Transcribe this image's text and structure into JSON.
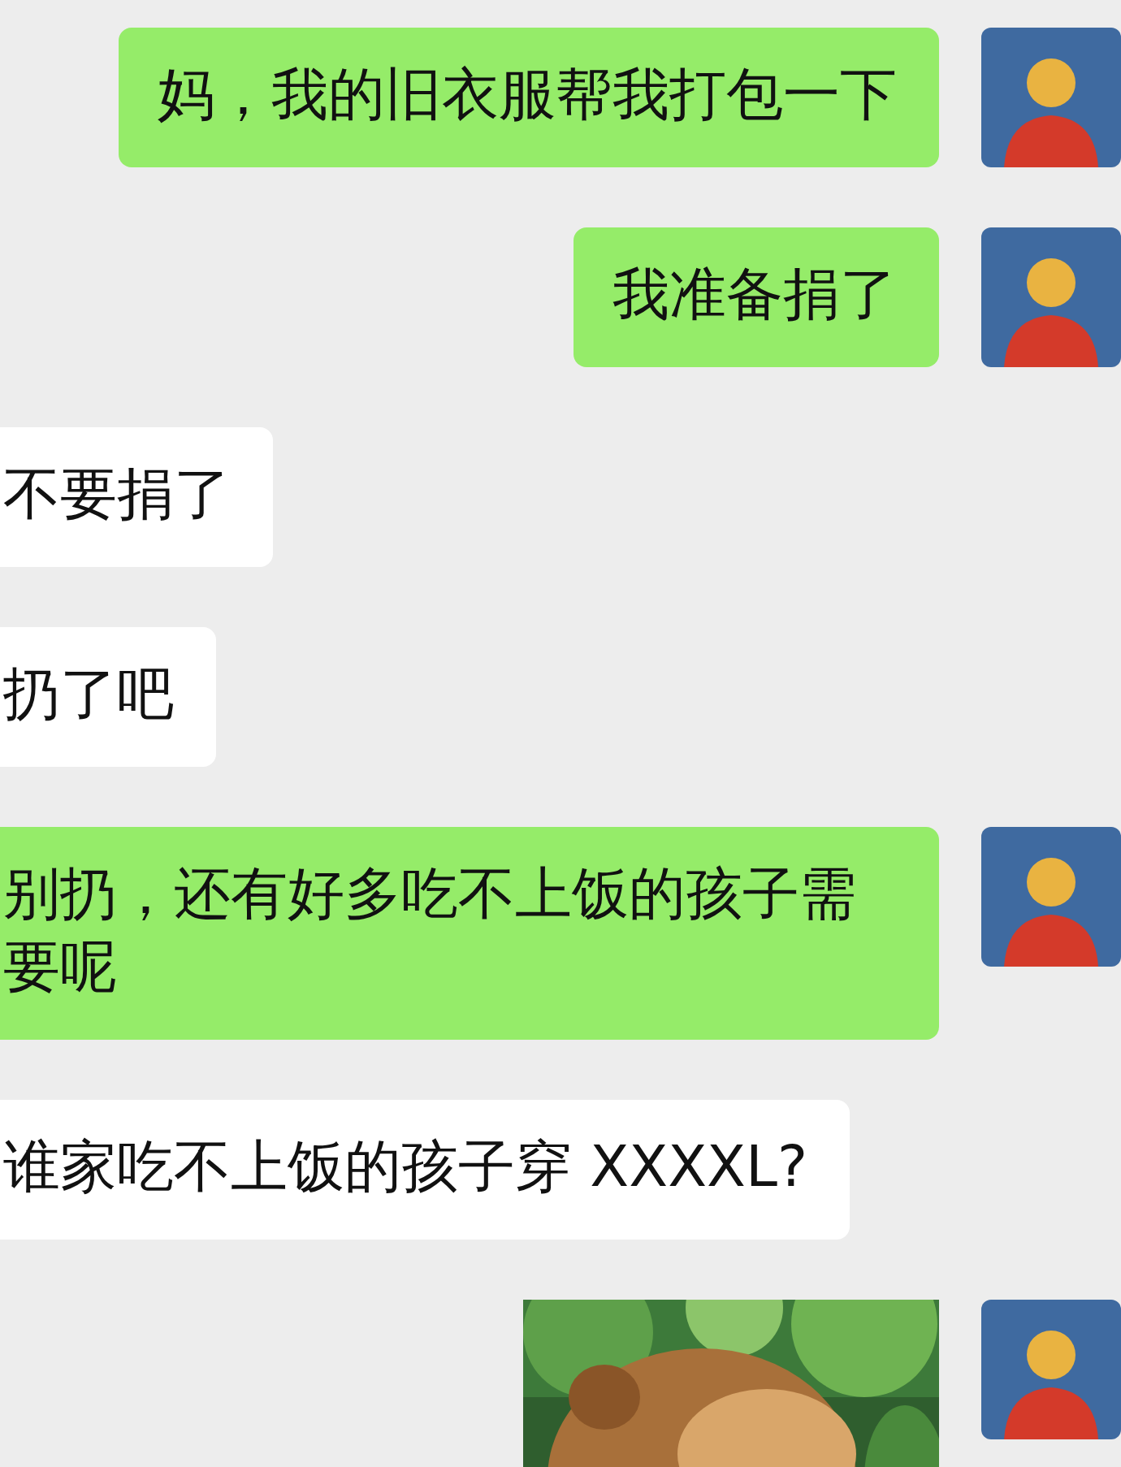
{
  "messages": [
    {
      "outgoing": true,
      "kind": "text",
      "text": "妈，我的旧衣服帮我打包一下"
    },
    {
      "outgoing": true,
      "kind": "text",
      "text": "我准备捐了"
    },
    {
      "outgoing": false,
      "kind": "text",
      "text": "不要捐了"
    },
    {
      "outgoing": false,
      "kind": "text",
      "text": "扔了吧"
    },
    {
      "outgoing": true,
      "kind": "text",
      "text": "别扔，还有好多吃不上饭的孩子需要呢"
    },
    {
      "outgoing": false,
      "kind": "text",
      "text": "谁家吃不上饭的孩子穿 XXXXL?"
    },
    {
      "outgoing": true,
      "kind": "picture"
    }
  ]
}
